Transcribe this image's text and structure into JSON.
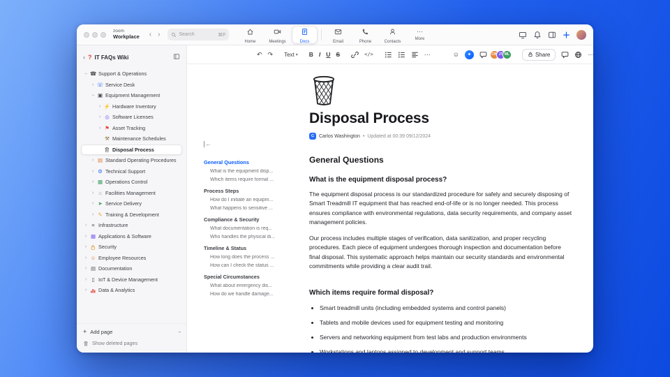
{
  "accent": "#0b5cff",
  "titlebar": {
    "brand_top": "zoom",
    "brand_bottom": "Workplace",
    "search": {
      "placeholder": "Search",
      "shortcut": "⌘F"
    },
    "tabs": [
      {
        "label": "Home",
        "active": false
      },
      {
        "label": "Meetings",
        "active": false
      },
      {
        "label": "Docs",
        "active": true
      },
      {
        "label": "Email",
        "active": false
      },
      {
        "label": "Phone",
        "active": false
      },
      {
        "label": "Contacts",
        "active": false
      },
      {
        "label": "More",
        "active": false
      }
    ]
  },
  "sidebar": {
    "wiki_badge": "?",
    "title": "IT FAQs Wiki",
    "tree": [
      {
        "label": "Support & Operations",
        "level": 0,
        "icon": "phone-icon",
        "chevron": "down"
      },
      {
        "label": "Service Desk",
        "level": 1,
        "icon": "headset-icon",
        "chevron": "right"
      },
      {
        "label": "Equipment Management",
        "level": 1,
        "icon": "monitor-icon",
        "chevron": "down"
      },
      {
        "label": "Hardware Inventory",
        "level": 2,
        "icon": "plug-icon",
        "chevron": "right"
      },
      {
        "label": "Software Licenses",
        "level": 2,
        "icon": "disc-icon",
        "chevron": "right"
      },
      {
        "label": "Asset Tracking",
        "level": 2,
        "icon": "pin-icon",
        "chevron": "right"
      },
      {
        "label": "Maintenance Schedules",
        "level": 2,
        "icon": "tools-icon",
        "chevron": "none"
      },
      {
        "label": "Disposal Process",
        "level": 2,
        "icon": "trash-icon",
        "chevron": "none",
        "selected": true
      },
      {
        "label": "Standard Operating Procedures",
        "level": 1,
        "icon": "book-icon",
        "chevron": "right"
      },
      {
        "label": "Technical Support",
        "level": 1,
        "icon": "wrench-icon",
        "chevron": "right"
      },
      {
        "label": "Operations Control",
        "level": 1,
        "icon": "sliders-icon",
        "chevron": "right"
      },
      {
        "label": "Facilities Management",
        "level": 1,
        "icon": "building-icon",
        "chevron": "right"
      },
      {
        "label": "Service Delivery",
        "level": 1,
        "icon": "truck-icon",
        "chevron": "right"
      },
      {
        "label": "Training & Development",
        "level": 1,
        "icon": "training-icon",
        "chevron": "right"
      },
      {
        "label": "Infrastructure",
        "level": 0,
        "icon": "infra-icon",
        "chevron": "right"
      },
      {
        "label": "Applications & Software",
        "level": 0,
        "icon": "apps-icon",
        "chevron": "right"
      },
      {
        "label": "Security",
        "level": 0,
        "icon": "security-icon",
        "chevron": "right"
      },
      {
        "label": "Employee Resources",
        "level": 0,
        "icon": "people-icon",
        "chevron": "right"
      },
      {
        "label": "Documentation",
        "level": 0,
        "icon": "doc-icon",
        "chevron": "right"
      },
      {
        "label": "IoT & Device Management",
        "level": 0,
        "icon": "device-icon",
        "chevron": "right"
      },
      {
        "label": "Data & Analytics",
        "level": 0,
        "icon": "chart-icon",
        "chevron": "right"
      }
    ],
    "add_page_label": "Add page",
    "show_deleted_label": "Show deleted pages"
  },
  "editor_toolbar": {
    "text_style_label": "Text",
    "bold_label": "B",
    "italic_label": "I",
    "underline_label": "U",
    "strike_label": "S",
    "code_label": "</>",
    "share_label": "Share",
    "collaborators": [
      {
        "initials": "CW",
        "color": "#e8883d"
      },
      {
        "initials": "JT",
        "color": "#7a5cf0"
      },
      {
        "initials": "ML",
        "color": "#3d9e63"
      }
    ]
  },
  "toc": {
    "sections": [
      {
        "title": "General Questions",
        "active": true,
        "items": [
          "What is the equipment disp...",
          "Which items require formal ..."
        ]
      },
      {
        "title": "Process Steps",
        "active": false,
        "items": [
          "How do I initiate an equipm...",
          "What happens to sensitive ..."
        ]
      },
      {
        "title": "Compliance & Security",
        "active": false,
        "items": [
          "What documentation is req...",
          "Who handles the physical di..."
        ]
      },
      {
        "title": "Timeline & Status",
        "active": false,
        "items": [
          "How long does the process ...",
          "How can I check the status ..."
        ]
      },
      {
        "title": "Special Circumstances",
        "active": false,
        "items": [
          "What about emergency dis...",
          "How do we handle damage..."
        ]
      }
    ]
  },
  "doc": {
    "title": "Disposal Process",
    "author": "Carlos Washington",
    "byline_separator": "•",
    "updated": "Updated at 00:39 09/12/2024",
    "sections": [
      {
        "heading": "General Questions",
        "subsections": [
          {
            "heading": "What is the equipment disposal process?",
            "paragraphs": [
              "The equipment disposal process is our standardized procedure for safely and securely disposing of Smart Treadmill IT equipment that has reached end-of-life or is no longer needed. This process ensures compliance with environmental regulations, data security requirements, and company asset management policies.",
              "Our process includes multiple stages of verification, data sanitization, and proper recycling procedures. Each piece of equipment undergoes thorough inspection and documentation before final disposal. This systematic approach helps maintain our security standards and environmental commitments while providing a clear audit trail."
            ],
            "bullets": []
          },
          {
            "heading": "Which items require formal disposal?",
            "paragraphs": [],
            "bullets": [
              "Smart treadmill units (including embedded systems and control panels)",
              "Tablets and mobile devices used for equipment testing and monitoring",
              "Servers and networking equipment from test labs and production environments",
              "Workstations and laptops assigned to development and support teams"
            ]
          }
        ]
      }
    ]
  }
}
